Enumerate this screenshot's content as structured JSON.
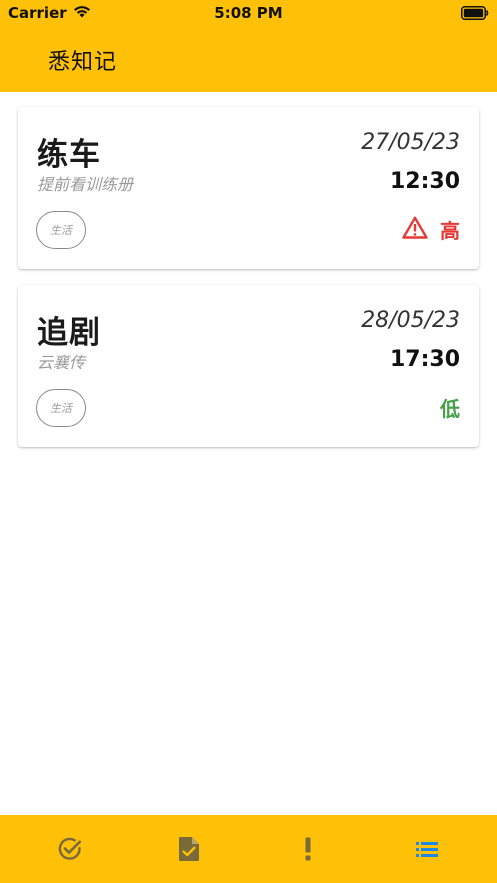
{
  "status_bar": {
    "carrier": "Carrier",
    "time": "5:08 PM"
  },
  "app": {
    "title": "悉知记"
  },
  "tasks": [
    {
      "title": "练车",
      "subtitle": "提前看训练册",
      "date": "27/05/23",
      "time": "12:30",
      "tag": "生活",
      "priority": "高",
      "priority_icon": "warning-triangle-icon",
      "priority_color": "#E53935"
    },
    {
      "title": "追剧",
      "subtitle": "云襄传",
      "date": "28/05/23",
      "time": "17:30",
      "tag": "生活",
      "priority": "低",
      "priority_color": "#43A047"
    }
  ],
  "bottom_nav": [
    {
      "icon": "check-circle-icon"
    },
    {
      "icon": "task-document-icon"
    },
    {
      "icon": "exclamation-icon"
    },
    {
      "icon": "list-icon",
      "active": true
    }
  ],
  "colors": {
    "brand": "#FFC107",
    "nav_icon": "#7A6A3A",
    "nav_icon_active": "#1E88E5",
    "priority_high": "#E53935",
    "priority_low": "#43A047"
  }
}
